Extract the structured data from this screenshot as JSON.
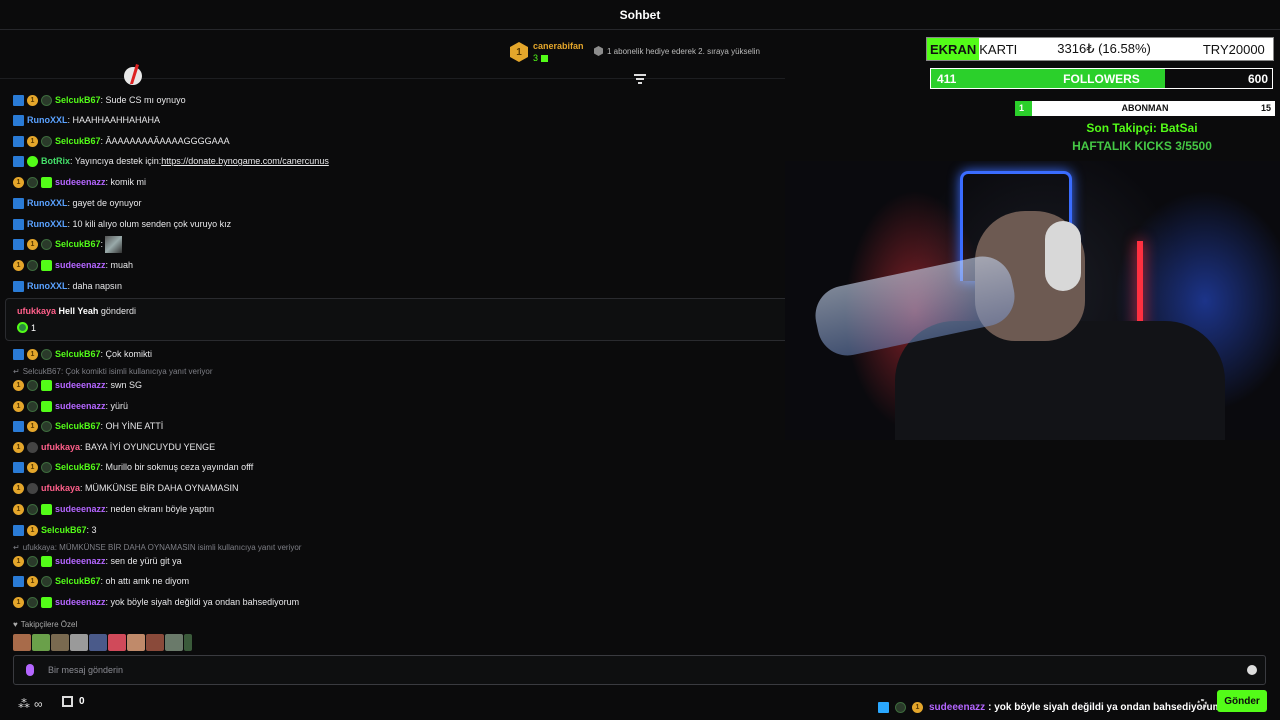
{
  "header": {
    "title": "Sohbet"
  },
  "pinned": {
    "rank": "1",
    "username": "canerabifan",
    "gift_count": "3",
    "message": "1 abonelik hediye ederek 2. sıraya yükselin"
  },
  "messages": [
    {
      "user": "SelcukB67",
      "text": ": Sude CS mı oynuyo",
      "color": "green",
      "badges": [
        "mod",
        "tier",
        "gift"
      ]
    },
    {
      "user": "RunoXXL",
      "text": ": HAAHHAAHHAHAHA",
      "color": "blue",
      "badges": [
        "mod"
      ]
    },
    {
      "user": "SelcukB67",
      "text": ": ÂAAAAAAAÂAAAAGGGGAAA",
      "color": "green",
      "badges": [
        "mod",
        "tier",
        "gift"
      ]
    },
    {
      "user": "BotRix",
      "text": ": Yayıncıya destek için: ",
      "link": "https://donate.bynogame.com/canercunus",
      "color": "lime",
      "badges": [
        "mod",
        "verified"
      ]
    },
    {
      "user": "sudeeenazz",
      "text": ": komik mi",
      "color": "purple",
      "badges": [
        "tier",
        "gift",
        "sub"
      ]
    },
    {
      "user": "RunoXXL",
      "text": ": gayet de oynuyor",
      "color": "blue",
      "badges": [
        "mod"
      ]
    },
    {
      "user": "RunoXXL",
      "text": ": 10 kili alıyo olum senden çok vuruyo kız",
      "color": "blue",
      "badges": [
        "mod"
      ]
    },
    {
      "user": "SelcukB67",
      "text": ":",
      "color": "green",
      "badges": [
        "mod",
        "tier",
        "gift"
      ],
      "emote": true
    },
    {
      "user": "sudeeenazz",
      "text": ": muah",
      "color": "purple",
      "badges": [
        "tier",
        "gift",
        "sub"
      ]
    },
    {
      "user": "RunoXXL",
      "text": ": daha napsın",
      "color": "blue",
      "badges": [
        "mod"
      ]
    }
  ],
  "gift_card": {
    "user": "ufukkaya",
    "item": "Hell Yeah",
    "action": "gönderdi",
    "count": "1"
  },
  "messages2": [
    {
      "user": "SelcukB67",
      "text": ": Çok komikti",
      "color": "green",
      "badges": [
        "mod",
        "tier",
        "gift"
      ]
    },
    {
      "user": "sudeeenazz",
      "text": ": swn SG",
      "color": "purple",
      "badges": [
        "tier",
        "gift",
        "sub"
      ]
    },
    {
      "user": "sudeeenazz",
      "text": ": yürü",
      "color": "purple",
      "badges": [
        "tier",
        "gift",
        "sub"
      ]
    },
    {
      "user": "SelcukB67",
      "text": ": OH YİNE ATTİ",
      "color": "green",
      "badges": [
        "mod",
        "tier",
        "gift"
      ]
    },
    {
      "user": "ufukkaya",
      "text": ": BAYA İYİ OYUNCUYDU YENGE",
      "color": "pink",
      "badges": [
        "tier",
        "moon"
      ]
    },
    {
      "user": "SelcukB67",
      "text": ": Murillo bir sokmuş ceza yayından offf",
      "color": "green",
      "badges": [
        "mod",
        "tier",
        "gift"
      ]
    },
    {
      "user": "ufukkaya",
      "text": ": MÜMKÜNSE BİR DAHA OYNAMASIN",
      "color": "pink",
      "badges": [
        "tier",
        "moon"
      ]
    },
    {
      "user": "sudeeenazz",
      "text": ": neden ekranı böyle yaptın",
      "color": "purple",
      "badges": [
        "tier",
        "gift",
        "sub"
      ]
    },
    {
      "user": "SelcukB67",
      "text": ": 3",
      "color": "green",
      "badges": [
        "mod",
        "tier"
      ]
    },
    {
      "user": "sudeeenazz",
      "text": ": sen de yürü git ya",
      "color": "purple",
      "badges": [
        "tier",
        "gift",
        "sub"
      ]
    },
    {
      "user": "SelcukB67",
      "text": ": oh attı amk ne diyom",
      "color": "green",
      "badges": [
        "mod",
        "tier",
        "gift"
      ]
    },
    {
      "user": "sudeeenazz",
      "text": ": yok böyle siyah değildi ya ondan bahsediyorum",
      "color": "purple",
      "badges": [
        "tier",
        "gift",
        "sub"
      ]
    }
  ],
  "replies": {
    "r1": "SelcukB67: Çok komikti isimli kullanıcıya yanıt veriyor",
    "r2": "ufukkaya: MÜMKÜNSE BİR DAHA OYNAMASIN isimli kullanıcıya yanıt veriyor"
  },
  "badge_labels": {
    "tier": "1"
  },
  "followers_only": "Takipçilere Özel",
  "input": {
    "placeholder": "Bir mesaj gönderin"
  },
  "bottom": {
    "sub_count": "0",
    "ticker_user": "sudeeenazz",
    "ticker_text": ": yok böyle siyah değildi ya ondan bahsediyorum",
    "send_label": "Gönder"
  },
  "overlay": {
    "gpu_highlight": "EKRAN",
    "gpu_rest": "KARTI",
    "gpu_price": "3316₺ (16.58%)",
    "gpu_goal": "TRY20000",
    "followers_current": "411",
    "followers_label": "FOLLOWERS",
    "followers_goal": "600",
    "followers_progress": 0.685,
    "subs_current": "1",
    "subs_label": "ABONMAN",
    "subs_goal": "15",
    "subs_progress": 0.067,
    "last_follower": "Son Takipçi: BatSai",
    "weekly_kicks": "HAFTALIK KICKS 3/5500"
  },
  "colors": {
    "accent": "#53fc18",
    "mod": "#2a7bd6",
    "tier": "#e4a62b"
  }
}
